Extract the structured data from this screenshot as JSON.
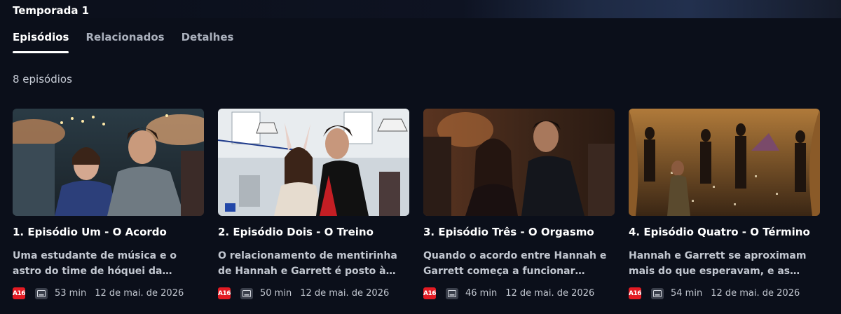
{
  "season": {
    "title": "Temporada 1"
  },
  "tabs": [
    {
      "label": "Episódios",
      "active": true
    },
    {
      "label": "Relacionados",
      "active": false
    },
    {
      "label": "Detalhes",
      "active": false
    }
  ],
  "episode_count": "8 episódios",
  "episodes": [
    {
      "title": "1. Episódio Um - O Acordo",
      "description": "Uma estudante de música e o astro do time de hóquei da universidade…",
      "rating": "A16",
      "duration": "53 min",
      "date": "12 de mai. de 2026"
    },
    {
      "title": "2. Episódio Dois - O Treino",
      "description": "O relacionamento de mentirinha de Hannah e Garrett é posto à prova…",
      "rating": "A16",
      "duration": "50 min",
      "date": "12 de mai. de 2026"
    },
    {
      "title": "3. Episódio Três - O Orgasmo",
      "description": "Quando o acordo entre Hannah e Garrett começa a funcionar bem,…",
      "rating": "A16",
      "duration": "46 min",
      "date": "12 de mai. de 2026"
    },
    {
      "title": "4. Episódio Quatro - O Término",
      "description": "Hannah e Garrett se aproximam mais do que esperavam, e as coisa…",
      "rating": "A16",
      "duration": "54 min",
      "date": "12 de mai. de 2026"
    }
  ],
  "colors": {
    "background": "#0b0f1a",
    "rating_badge": "#e31b23",
    "text_muted": "#c2c7d0"
  }
}
